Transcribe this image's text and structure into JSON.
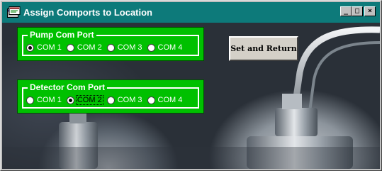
{
  "window": {
    "title": "Assign Comports to Location",
    "minimize_label": "_",
    "maximize_label": "□",
    "close_label": "×"
  },
  "pump_group": {
    "title": "Pump Com Port",
    "options": [
      "COM 1",
      "COM 2",
      "COM 3",
      "COM 4"
    ],
    "selected": "COM 1"
  },
  "detector_group": {
    "title": "Detector Com Port",
    "options": [
      "COM 1",
      "COM 2",
      "COM 3",
      "COM 4"
    ],
    "selected": "COM 2"
  },
  "set_return_label": "Set and Return",
  "colors": {
    "titlebar": "#0d7a7a",
    "group_green": "#00c000",
    "button_face": "#d4d0c8"
  },
  "icons": {
    "app": "app-window-icon",
    "minimize": "minimize-icon",
    "maximize": "maximize-icon",
    "close": "close-icon"
  }
}
